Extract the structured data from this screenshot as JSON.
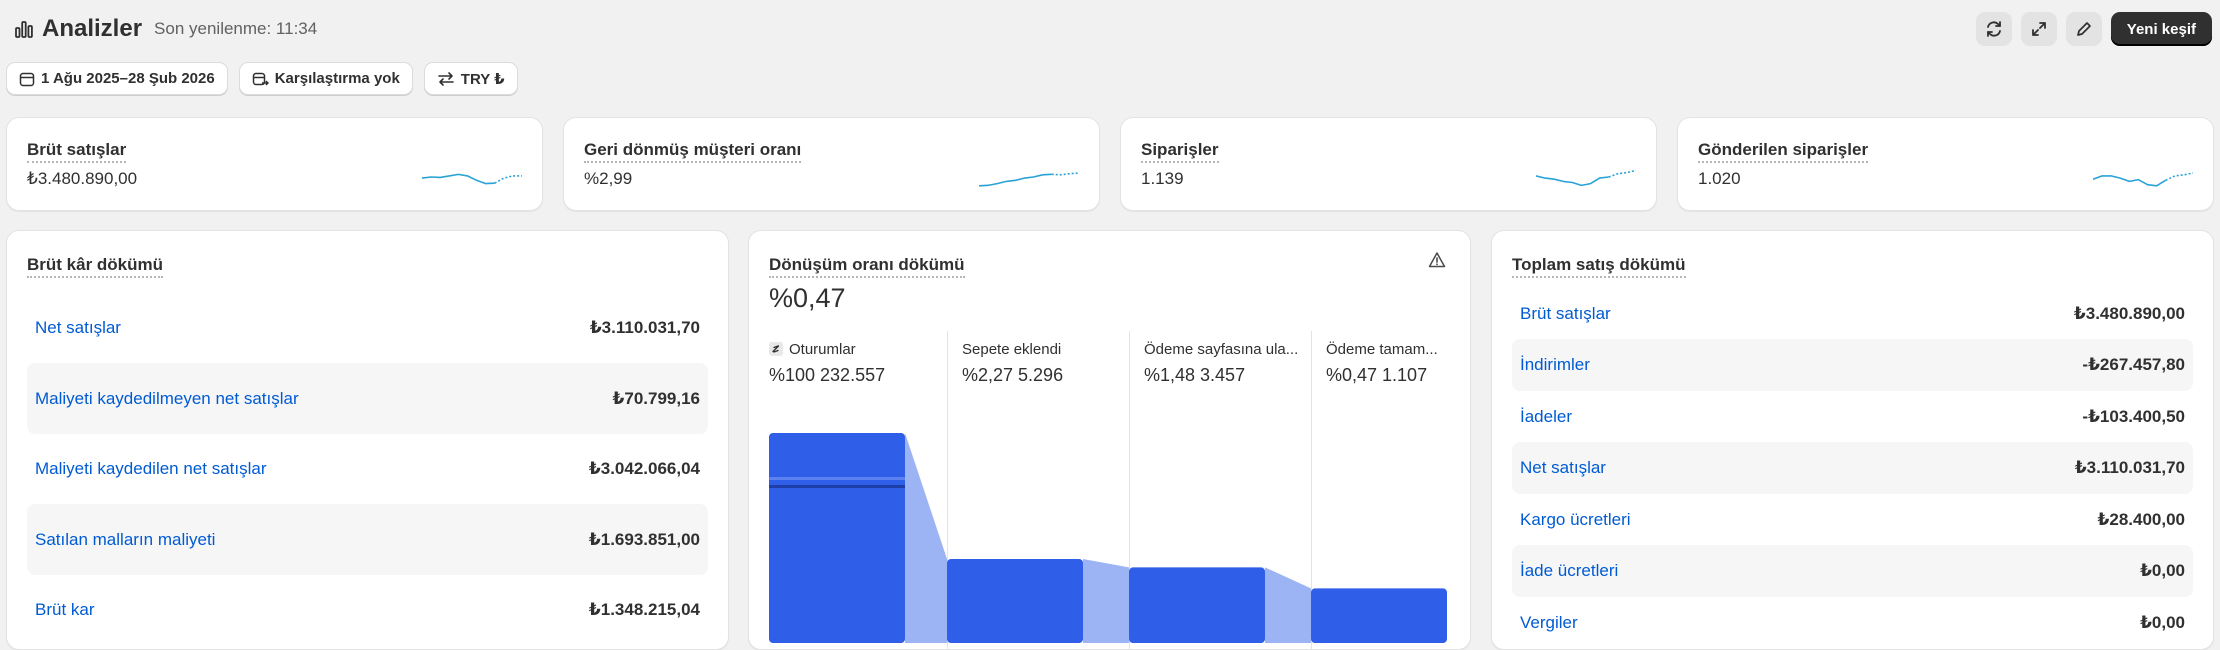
{
  "header": {
    "title": "Analizler",
    "refresh_text": "Son yenilenme: 11:34",
    "new_explore_label": "Yeni keşif"
  },
  "filters": {
    "date_range": "1 Ağu 2025–28 Şub 2026",
    "comparison": "Karşılaştırma yok",
    "currency": "TRY ₺"
  },
  "metrics": [
    {
      "label": "Brüt satışlar",
      "value": "₺3.480.890,00",
      "spark": [
        0.45,
        0.5,
        0.48,
        0.55,
        0.62,
        0.55,
        0.35,
        0.2,
        0.22,
        0.45,
        0.55,
        0.55
      ]
    },
    {
      "label": "Geri dönmüş müşteri oranı",
      "value": "%2,99",
      "spark": [
        0.1,
        0.12,
        0.2,
        0.3,
        0.35,
        0.45,
        0.5,
        0.6,
        0.62,
        0.6,
        0.65,
        0.68
      ]
    },
    {
      "label": "Siparişler",
      "value": "1.139",
      "spark": [
        0.55,
        0.45,
        0.4,
        0.3,
        0.25,
        0.12,
        0.2,
        0.45,
        0.5,
        0.65,
        0.7,
        0.8
      ]
    },
    {
      "label": "Gönderilen siparişler",
      "value": "1.020",
      "spark": [
        0.4,
        0.55,
        0.55,
        0.45,
        0.3,
        0.38,
        0.15,
        0.1,
        0.35,
        0.55,
        0.6,
        0.68
      ]
    }
  ],
  "gross_profit": {
    "title": "Brüt kâr dökümü",
    "rows": [
      {
        "label": "Net satışlar",
        "value": "₺3.110.031,70"
      },
      {
        "label": "Maliyeti kaydedilmeyen net satışlar",
        "value": "₺70.799,16"
      },
      {
        "label": "Maliyeti kaydedilen net satışlar",
        "value": "₺3.042.066,04"
      },
      {
        "label": "Satılan malların maliyeti",
        "value": "₺1.693.851,00"
      },
      {
        "label": "Brüt kar",
        "value": "₺1.348.215,04"
      }
    ]
  },
  "conversion": {
    "title": "Dönüşüm oranı dökümü",
    "rate": "%0,47",
    "stages": [
      {
        "name": "Oturumlar",
        "value": "%100 232.557",
        "fraction": 1.0
      },
      {
        "name": "Sepete eklendi",
        "value": "%2,27 5.296",
        "fraction": 0.4
      },
      {
        "name": "Ödeme sayfasına ula...",
        "value": "%1,48 3.457",
        "fraction": 0.36
      },
      {
        "name": "Ödeme tamam...",
        "value": "%0,47 1.107",
        "fraction": 0.26
      }
    ],
    "accent_color": "#2f5ee8"
  },
  "total_sales": {
    "title": "Toplam satış dökümü",
    "rows": [
      {
        "label": "Brüt satışlar",
        "value": "₺3.480.890,00"
      },
      {
        "label": "İndirimler",
        "value": "-₺267.457,80"
      },
      {
        "label": "İadeler",
        "value": "-₺103.400,50"
      },
      {
        "label": "Net satışlar",
        "value": "₺3.110.031,70"
      },
      {
        "label": "Kargo ücretleri",
        "value": "₺28.400,00"
      },
      {
        "label": "İade ücretleri",
        "value": "₺0,00"
      },
      {
        "label": "Vergiler",
        "value": "₺0,00"
      }
    ]
  },
  "colors": {
    "link": "#005bd3",
    "sparkline": "#29a3d6",
    "funnel_bar": "#2f5ee8",
    "funnel_connector": "#9db4f4"
  }
}
